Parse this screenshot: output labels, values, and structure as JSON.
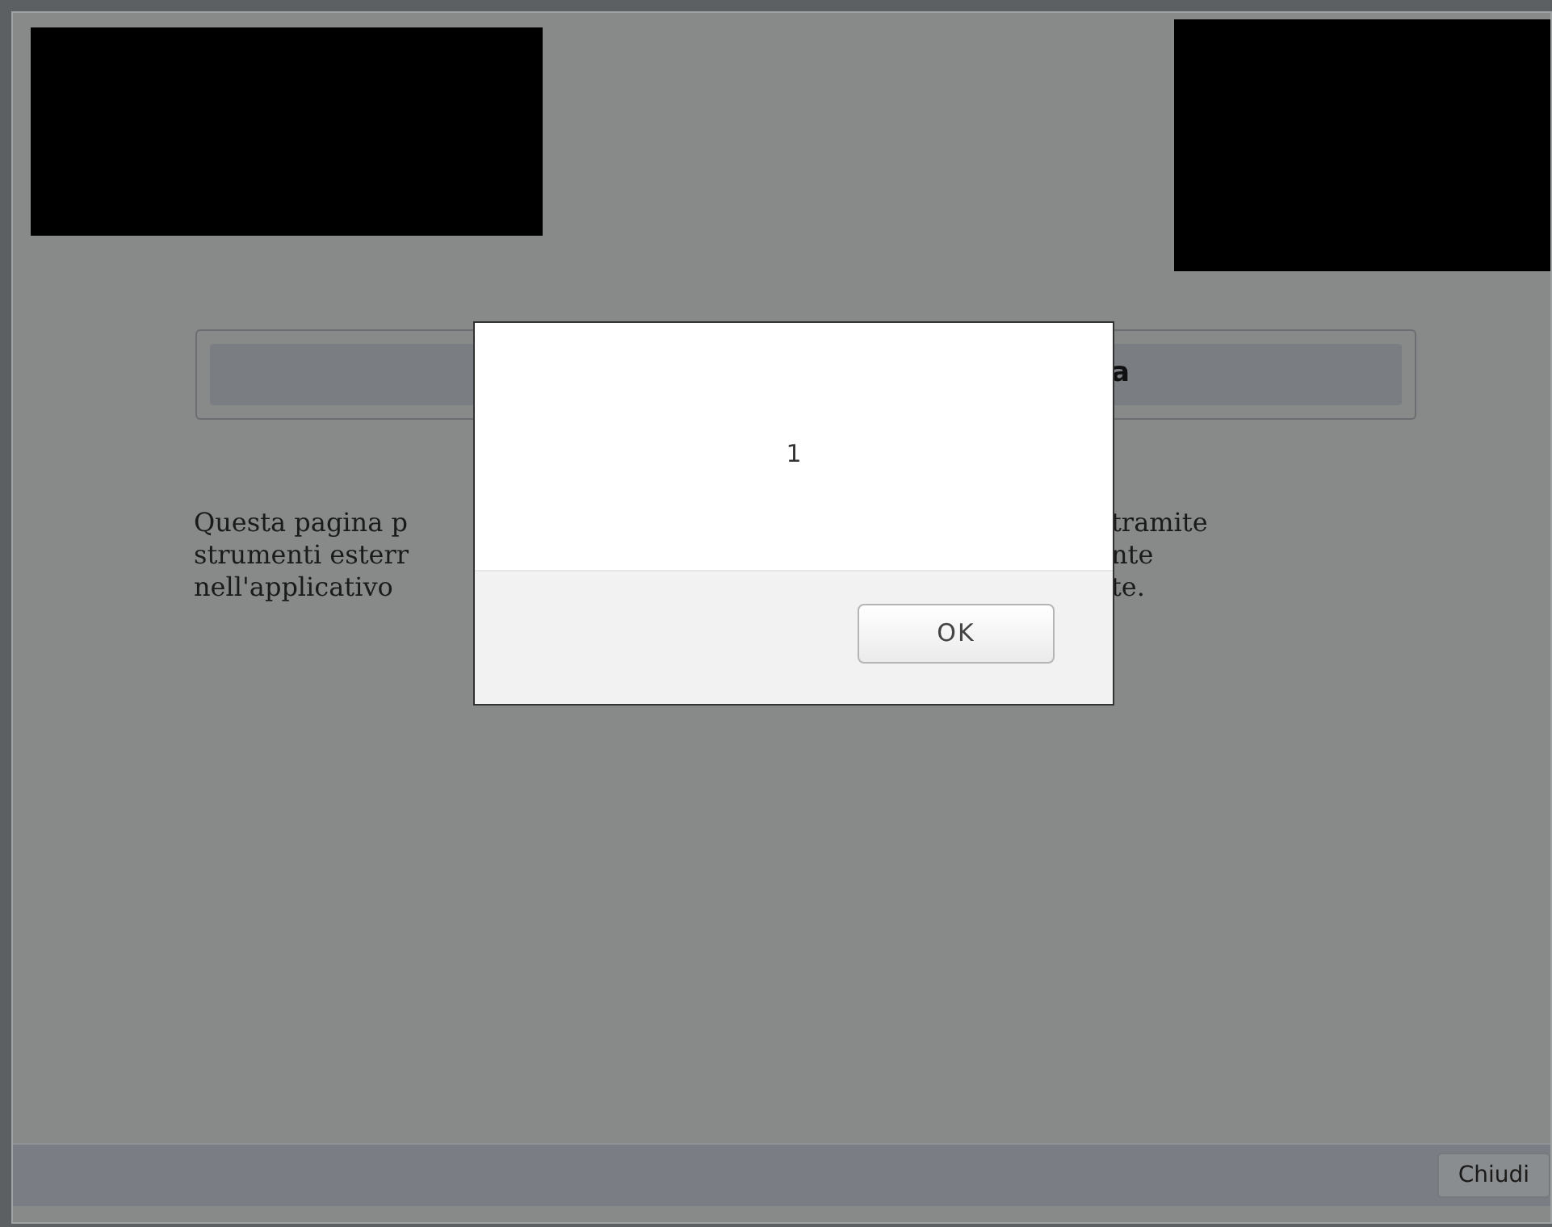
{
  "header": {
    "title_visible": "a"
  },
  "paragraph_lines": [
    {
      "left": "Questa pagina p",
      "right": "tramite"
    },
    {
      "left": "strumenti esterr",
      "right": "nte"
    },
    {
      "left": "nell'applicativo",
      "right": "te."
    }
  ],
  "footer": {
    "button": "Chiudi"
  },
  "dialog": {
    "message": "1",
    "button": "OK"
  }
}
